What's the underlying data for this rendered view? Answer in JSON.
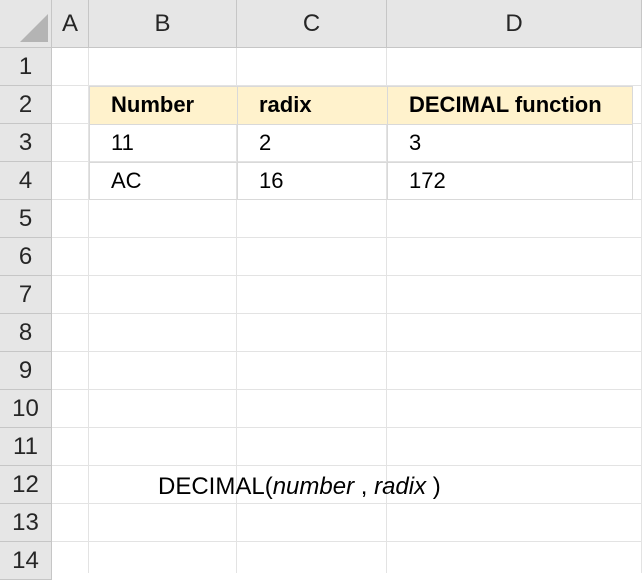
{
  "columns": [
    "A",
    "B",
    "C",
    "D"
  ],
  "rows": [
    "1",
    "2",
    "3",
    "4",
    "5",
    "6",
    "7",
    "8",
    "9",
    "10",
    "11",
    "12",
    "13",
    "14"
  ],
  "table": {
    "headers": [
      "Number",
      "radix",
      "DECIMAL function"
    ],
    "rows": [
      [
        "11",
        "2",
        "3"
      ],
      [
        "AC",
        "16",
        "172"
      ]
    ],
    "header_fill": "#fff2cc"
  },
  "formula": {
    "prefix": "DECIMAL(",
    "arg1": "number",
    "sep": " , ",
    "arg2": "radix",
    "suffix": " )"
  }
}
